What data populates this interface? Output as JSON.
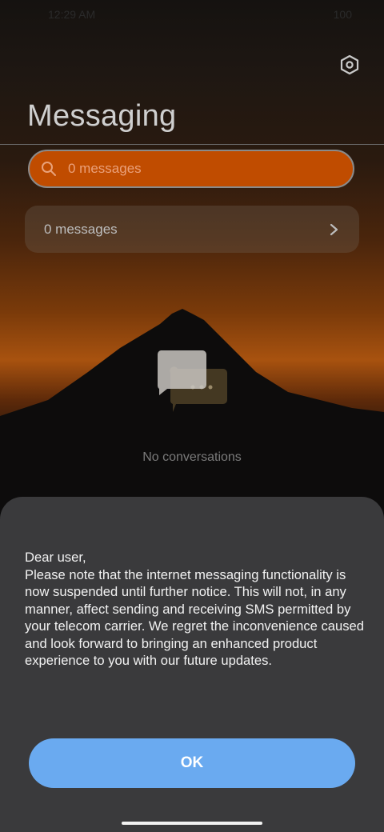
{
  "status_bar": {
    "time": "12:29 AM",
    "battery": "100"
  },
  "header": {
    "title": "Messaging",
    "settings_icon": "settings-hexagon-icon"
  },
  "search": {
    "placeholder": "0 messages",
    "icon": "search-icon"
  },
  "messages_row": {
    "label": "0 messages",
    "icon": "chevron-right-icon"
  },
  "empty_state": {
    "icon": "chat-bubbles-icon",
    "text": "No conversations"
  },
  "notice": {
    "greeting": "Dear user,",
    "body": "Please note that the internet messaging functionality is now suspended until further notice. This will not, in any manner, affect sending and receiving SMS permitted by your telecom carrier. We regret the inconvenience caused and look forward to bringing an enhanced product experience to you with our future updates.",
    "button_label": "OK"
  },
  "colors": {
    "search_bg": "#c04c00",
    "ok_button": "#6aaaf0",
    "sheet_bg": "#3a3a3c"
  }
}
